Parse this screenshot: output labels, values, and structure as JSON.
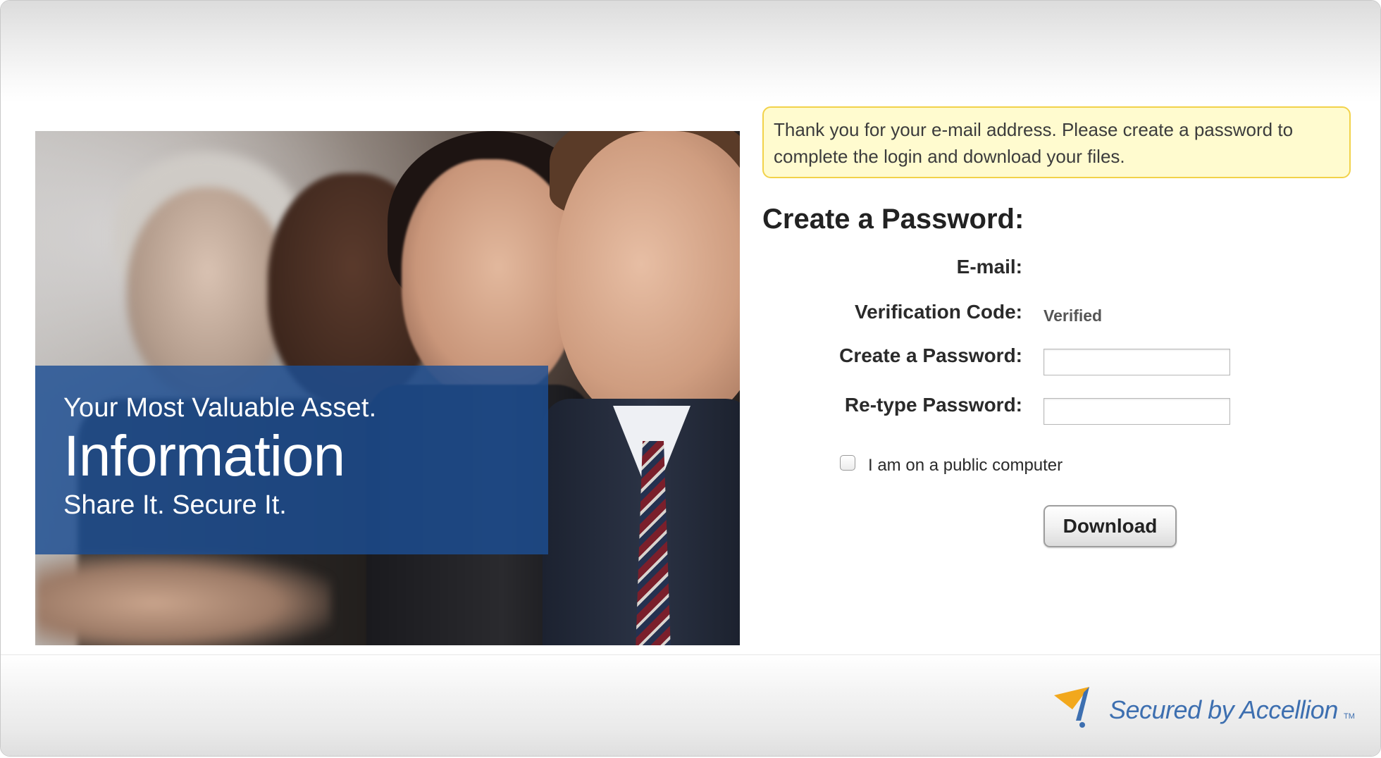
{
  "notice": {
    "text": "Thank you for your e-mail address. Please create a password to complete the login and download your files."
  },
  "hero": {
    "line1": "Your Most Valuable Asset.",
    "line2": "Information",
    "line3": "Share It. Secure It."
  },
  "form": {
    "title": "Create a Password:",
    "email_label": "E-mail:",
    "email_value": "",
    "verification_label": "Verification Code:",
    "verification_value": "Verified",
    "password_label": "Create a Password:",
    "password_value": "",
    "retype_label": "Re-type Password:",
    "retype_value": "",
    "public_computer_label": "I am on a public computer",
    "public_computer_checked": false,
    "download_label": "Download"
  },
  "footer": {
    "brand_text": "Secured by Accellion",
    "brand_tm": "TM",
    "logo_icon": "accellion-logo-icon"
  },
  "colors": {
    "banner_blue": "#1c4e94",
    "notice_bg": "#fffbcf",
    "notice_border": "#f2d24a",
    "brand_blue": "#3d6fb0",
    "brand_orange": "#f2a81d"
  }
}
